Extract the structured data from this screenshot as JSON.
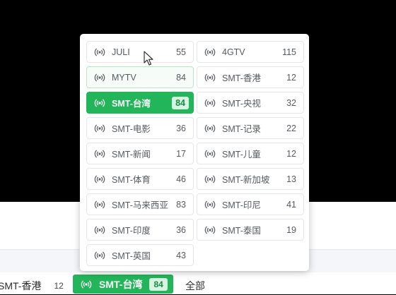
{
  "colors": {
    "accent": "#22b55a",
    "accent_badge_bg": "#d7f3e1",
    "accent_badge_text": "#1a8c44",
    "chip_border": "#e3e6ea",
    "text": "#555a60"
  },
  "popover": {
    "items": [
      {
        "label": "JULI",
        "count": "55",
        "icon": "broadcast-icon",
        "state": "normal"
      },
      {
        "label": "4GTV",
        "count": "115",
        "icon": "broadcast-icon",
        "state": "normal"
      },
      {
        "label": "MYTV",
        "count": "84",
        "icon": "broadcast-icon",
        "state": "hover"
      },
      {
        "label": "SMT-香港",
        "count": "12",
        "icon": "broadcast-icon",
        "state": "normal"
      },
      {
        "label": "SMT-台湾",
        "count": "84",
        "icon": "broadcast-icon",
        "state": "selected"
      },
      {
        "label": "SMT-央视",
        "count": "32",
        "icon": "broadcast-icon",
        "state": "normal"
      },
      {
        "label": "SMT-电影",
        "count": "36",
        "icon": "broadcast-icon",
        "state": "normal"
      },
      {
        "label": "SMT-记录",
        "count": "22",
        "icon": "broadcast-icon",
        "state": "normal"
      },
      {
        "label": "SMT-新闻",
        "count": "17",
        "icon": "broadcast-icon",
        "state": "normal"
      },
      {
        "label": "SMT-儿童",
        "count": "12",
        "icon": "broadcast-icon",
        "state": "normal"
      },
      {
        "label": "SMT-体育",
        "count": "46",
        "icon": "broadcast-icon",
        "state": "normal"
      },
      {
        "label": "SMT-新加坡",
        "count": "13",
        "icon": "broadcast-icon",
        "state": "normal"
      },
      {
        "label": "SMT-马来西亚",
        "count": "83",
        "icon": "broadcast-icon",
        "state": "normal"
      },
      {
        "label": "SMT-印尼",
        "count": "41",
        "icon": "broadcast-icon",
        "state": "normal"
      },
      {
        "label": "SMT-印度",
        "count": "36",
        "icon": "broadcast-icon",
        "state": "normal"
      },
      {
        "label": "SMT-泰国",
        "count": "19",
        "icon": "broadcast-icon",
        "state": "normal"
      },
      {
        "label": "SMT-英国",
        "count": "43",
        "icon": "broadcast-icon",
        "state": "normal"
      }
    ]
  },
  "filter_bar": {
    "previous": {
      "label": "SMT-香港",
      "count": "12"
    },
    "active": {
      "label": "SMT-台湾",
      "count": "84",
      "icon": "broadcast-icon"
    },
    "all_label": "全部"
  }
}
